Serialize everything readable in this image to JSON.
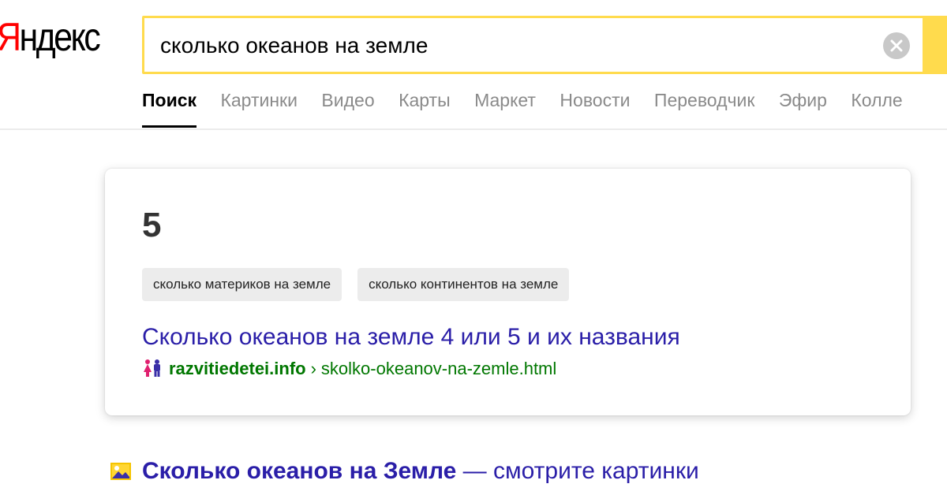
{
  "header": {
    "logo_first": "Я",
    "logo_rest": "ндекс",
    "search": {
      "value": "сколько океанов на земле",
      "placeholder": ""
    }
  },
  "tabs": [
    {
      "label": "Поиск",
      "active": true
    },
    {
      "label": "Картинки"
    },
    {
      "label": "Видео"
    },
    {
      "label": "Карты"
    },
    {
      "label": "Маркет"
    },
    {
      "label": "Новости"
    },
    {
      "label": "Переводчик"
    },
    {
      "label": "Эфир"
    },
    {
      "label": "Колле"
    }
  ],
  "answer": {
    "value": "5",
    "related": [
      "сколько материков на земле",
      "сколько континентов на земле"
    ],
    "source": {
      "title": "Сколько океанов на земле 4 или 5 и их названия",
      "domain": "razvitiedetei.info",
      "separator": "›",
      "path": "skolko-okeanov-na-zemle.html",
      "favicon": "children-icon"
    }
  },
  "results": [
    {
      "title_bold": "Сколько океанов на Земле",
      "title_rest": " — смотрите картинки",
      "icon": "image-icon"
    }
  ],
  "colors": {
    "accent_yellow": "#ffdb4d",
    "link_blue": "#2a1ea8",
    "url_green": "#007700",
    "logo_red": "#ff0000"
  }
}
